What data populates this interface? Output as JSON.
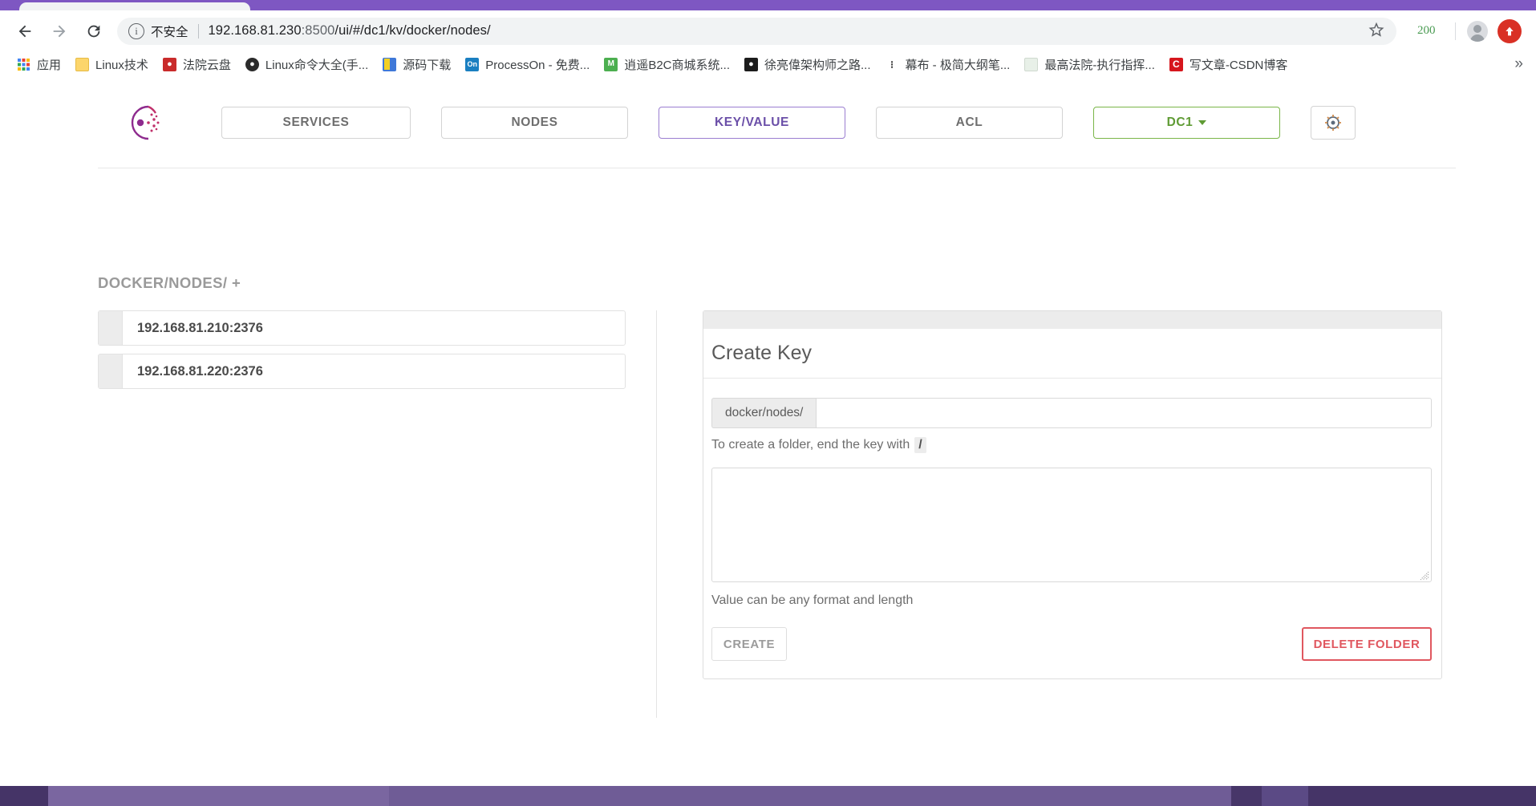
{
  "browser": {
    "security_label": "不安全",
    "url": "192.168.81.230",
    "url_port": ":8500",
    "url_path": "/ui/#/dc1/kv/docker/nodes/",
    "extension_badge": "200",
    "bookmarks": [
      {
        "label": "应用",
        "icon": "apps-grid-icon"
      },
      {
        "label": "Linux技术",
        "icon": "folder-icon",
        "letter": ""
      },
      {
        "label": "法院云盘",
        "icon": "cloud-disk-icon",
        "letter": "ʘ"
      },
      {
        "label": "Linux命令大全(手...",
        "icon": "tux-icon",
        "letter": "●"
      },
      {
        "label": "源码下载",
        "icon": "download-icon",
        "letter": "◤"
      },
      {
        "label": "ProcessOn - 免费...",
        "icon": "processon-icon",
        "letter": "On"
      },
      {
        "label": "逍遥B2C商城系统...",
        "icon": "mall-icon",
        "letter": "M"
      },
      {
        "label": "徐亮偉架构师之路...",
        "icon": "blog-icon",
        "letter": "●"
      },
      {
        "label": "幕布 - 极简大纲笔...",
        "icon": "mubu-icon",
        "letter": "∶"
      },
      {
        "label": "最高法院-执行指挥...",
        "icon": "court-icon",
        "letter": ""
      },
      {
        "label": "写文章-CSDN博客",
        "icon": "csdn-icon",
        "letter": "C"
      }
    ],
    "overflow_label": "»"
  },
  "consul": {
    "logo_name": "consul-logo",
    "nav": [
      {
        "id": "services",
        "label": "SERVICES",
        "state": "default"
      },
      {
        "id": "nodes",
        "label": "NODES",
        "state": "default"
      },
      {
        "id": "key-value",
        "label": "KEY/VALUE",
        "state": "active"
      },
      {
        "id": "acl",
        "label": "ACL",
        "state": "default"
      },
      {
        "id": "datacenter",
        "label": "DC1",
        "state": "datacenter"
      }
    ],
    "settings_icon": "gear-icon",
    "breadcrumb": "DOCKER/NODES/ +",
    "kv_items": [
      {
        "label": "192.168.81.210:2376"
      },
      {
        "label": "192.168.81.220:2376"
      }
    ],
    "panel": {
      "title": "Create Key",
      "key_prefix": "docker/nodes/",
      "key_value": "",
      "key_placeholder": "",
      "key_hint_text": "To create a folder, end the key with",
      "key_hint_code": "/",
      "value_text": "",
      "value_placeholder": "",
      "value_hint": "Value can be any format and length",
      "create_label": "CREATE",
      "delete_label": "DELETE FOLDER"
    }
  },
  "colors": {
    "chrome_purple": "#7e57c2",
    "kv_accent": "#9b7ed1",
    "kv_text": "#6b4fa8",
    "dc_accent": "#7ab648",
    "dc_text": "#5f9b34",
    "delete_red": "#e0575f",
    "badge_green": "#4a9b52"
  }
}
